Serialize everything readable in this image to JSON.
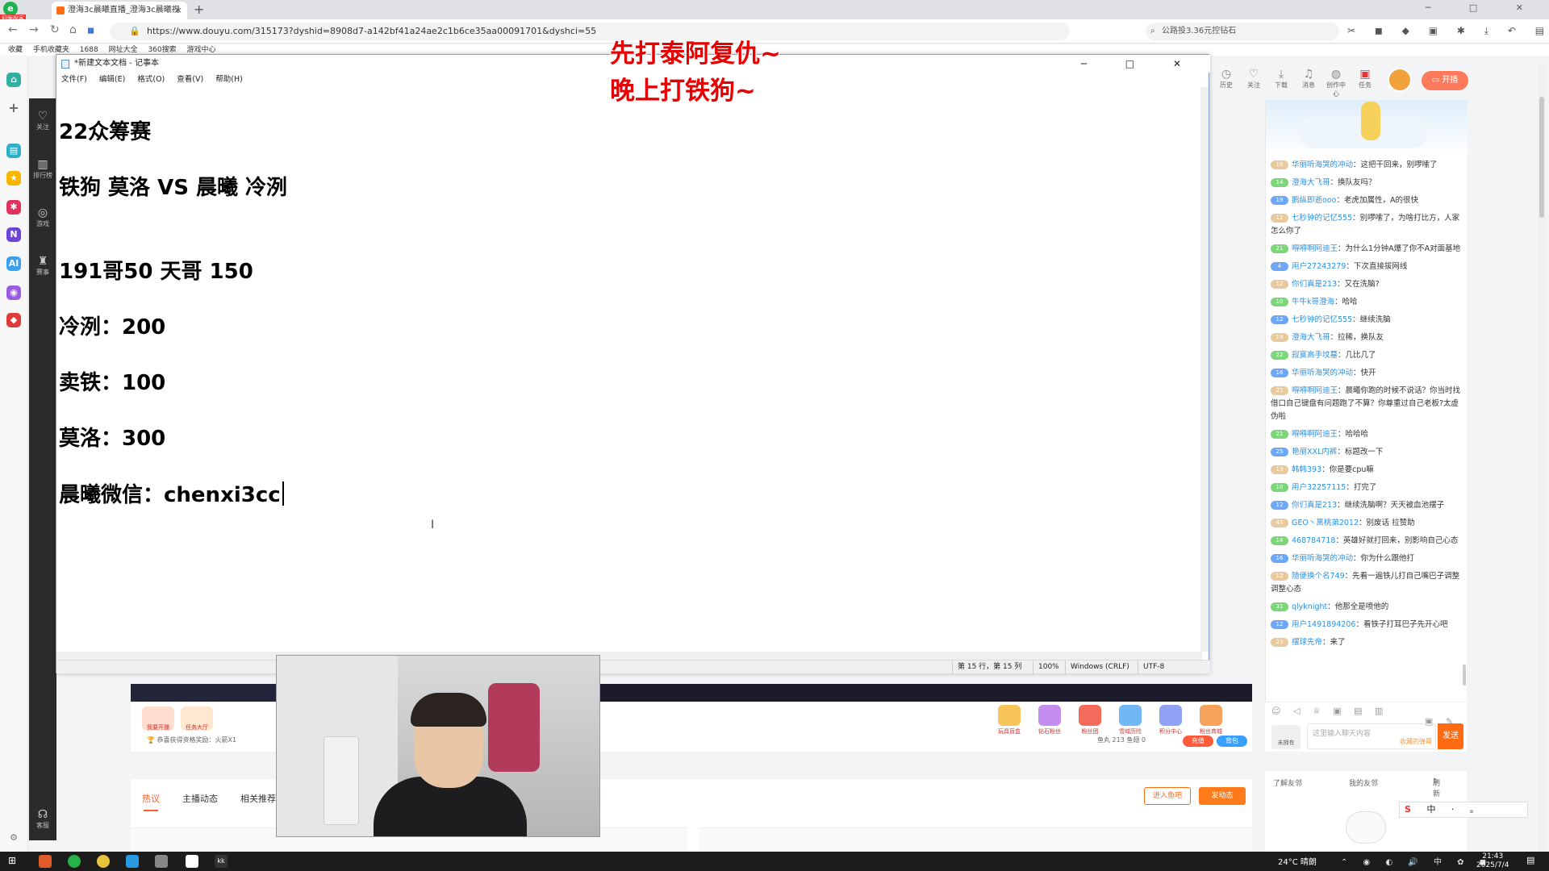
{
  "browser": {
    "brand_badge": "旧版极客",
    "tab_title": "澄海3c晨曦直播_澄海3c晨曦视",
    "tab_close": "×",
    "new_tab": "+",
    "url": "https://www.douyu.com/315173?dyshid=8908d7-a142bf41a24ae2c1b6ce35aa00091701&dyshci=55",
    "search_text": "公路投3.36元控钻石",
    "window_controls": "─ □ ✕"
  },
  "bookmarks": [
    "收藏",
    "手机收藏夹",
    "1688",
    "网址大全",
    "360搜索",
    "游戏中心"
  ],
  "sidebar": {
    "items": [
      {
        "icon": "heart-icon",
        "label": "关注"
      },
      {
        "icon": "ranking-icon",
        "label": "排行榜"
      },
      {
        "icon": "game-icon",
        "label": "游戏"
      },
      {
        "icon": "trophy-icon",
        "label": "赛事"
      },
      {
        "icon": "service-icon",
        "label": "客服"
      }
    ]
  },
  "overlay": {
    "line1": "先打泰阿复仇~",
    "line2": "晚上打铁狗~"
  },
  "top_nav": {
    "items": [
      {
        "icon": "history-icon",
        "label": "历史"
      },
      {
        "icon": "heart-icon",
        "label": "关注"
      },
      {
        "icon": "download-icon",
        "label": "下载"
      },
      {
        "icon": "bell-icon",
        "label": "消息"
      },
      {
        "icon": "bulb-icon",
        "label": "创作中心"
      },
      {
        "icon": "gift-icon",
        "label": "任务"
      }
    ],
    "live_label": "开播"
  },
  "notepad": {
    "title": "*新建文本文档 - 记事本",
    "menu": [
      "文件(F)",
      "编辑(E)",
      "格式(O)",
      "查看(V)",
      "帮助(H)"
    ],
    "lines": [
      "22众筹赛",
      "铁狗 莫洛  VS 晨曦 冷洌",
      "191哥50  天哥 150",
      "冷洌：200",
      "卖铁：100",
      "莫洛：300",
      "晨曦微信：chenxi3cc"
    ],
    "status": {
      "position": "第 15 行，第 15 列",
      "zoom": "100%",
      "eol": "Windows (CRLF)",
      "encoding": "UTF-8"
    }
  },
  "chat": {
    "messages": [
      {
        "level": "16",
        "user": "华丽听海哭的冲动",
        "text": "这把干回来，别啰嗦了"
      },
      {
        "level": "14",
        "user": "澄海大飞哥",
        "text": "换队友吗？"
      },
      {
        "level": "19",
        "user": "鹅纵即逝ooo",
        "text": "老虎加属性，A的很快"
      },
      {
        "level": "12",
        "user": "七秒钟的记忆555",
        "text": "别啰嗦了，为啥打比方，人家怎么你了"
      },
      {
        "level": "21",
        "user": "嘚嘚啊阿迪王",
        "text": "为什么1分钟A爆了你不A对面基地"
      },
      {
        "level": "4",
        "user": "用户27243279",
        "text": "下次直接拔网线"
      },
      {
        "level": "12",
        "user": "你们真是213",
        "text": "又在洗脑?"
      },
      {
        "level": "10",
        "user": "牛牛k哥澄海",
        "text": "哈哈"
      },
      {
        "level": "12",
        "user": "七秒钟的记忆555",
        "text": "继续洗脑"
      },
      {
        "level": "14",
        "user": "澄海大飞哥",
        "text": "拉稀，换队友"
      },
      {
        "level": "22",
        "user": "寂寞高手坟墓",
        "text": "几比几了"
      },
      {
        "level": "16",
        "user": "华丽听海哭的冲动",
        "text": "快开"
      },
      {
        "level": "21",
        "user": "嘚嘚啊阿迪王",
        "text": "晨曦你跑的时候不说话？你当时找借口自己键盘有问题跑了不算？你尊重过自己老板?太虚伪啦"
      },
      {
        "level": "21",
        "user": "嘚嘚啊阿迪王",
        "text": "哈哈哈"
      },
      {
        "level": "25",
        "user": "艳丽XXL内裤",
        "text": "标题改一下"
      },
      {
        "level": "13",
        "user": "韩韩393",
        "text": "你是要cpu嘛"
      },
      {
        "level": "10",
        "user": "用户32257115",
        "text": "打完了"
      },
      {
        "level": "12",
        "user": "你们真是213",
        "text": "继续洗脑啊？天天被血池摆子"
      },
      {
        "level": "43",
        "user": "GEO丶黑桃弟2012",
        "text": "别废话 拉赞助"
      },
      {
        "level": "14",
        "user": "468784718",
        "text": "英雄好就打回来，别影响自己心态"
      },
      {
        "level": "16",
        "user": "华丽听海哭的冲动",
        "text": "你为什么跟他打"
      },
      {
        "level": "12",
        "user": "随便换个名749",
        "text": "先看一遍铁儿打自己嘴巴子调整调整心态"
      },
      {
        "level": "31",
        "user": "qlyknight",
        "text": "他那全是喷他的"
      },
      {
        "level": "12",
        "user": "用户1491894206",
        "text": "看铁子打耳巴子先开心吧"
      },
      {
        "level": "23",
        "user": "摆球先帝",
        "text": "来了"
      }
    ],
    "input_placeholder": "这里输入聊天内容",
    "input_hint": "收藏的弹幕",
    "unowned_label": "未拥有",
    "send_label": "发送"
  },
  "friends": {
    "tab1": "了解友邻",
    "tab2": "我的友邻",
    "refresh": "刷新"
  },
  "gift_bar": {
    "btn1": "我要开播",
    "btn2": "任务大厅",
    "reward": "恭喜获得资格奖励：火箭X1",
    "gifts": [
      "玩具盲盒",
      "钻石粉丝",
      "粉丝团",
      "雪域历险",
      "积分中心",
      "粉丝商城"
    ],
    "balance": "鱼丸 213   鱼翅 0",
    "recharge": "充值",
    "backpack": "背包"
  },
  "page_tabs": {
    "tabs": [
      "热议",
      "主播动态",
      "相关推荐"
    ],
    "enter_fishbar": "进入鱼吧",
    "post": "发动态"
  },
  "taskbar": {
    "weather": "24°C 晴朗",
    "time": "21:43",
    "date": "2025/7/4"
  },
  "ime": {
    "text": "中 · 。"
  }
}
